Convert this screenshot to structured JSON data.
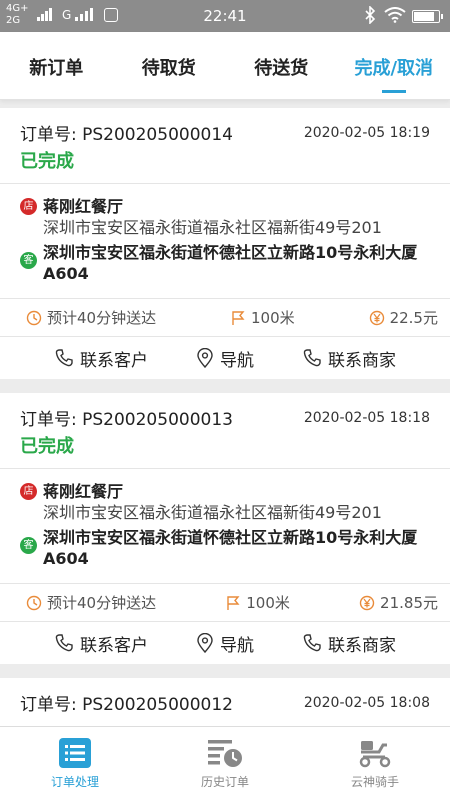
{
  "status_bar": {
    "net_top": "4G+",
    "net_bottom": "2G",
    "carrier2": "G",
    "time": "22:41"
  },
  "tabs": [
    {
      "label": "新订单"
    },
    {
      "label": "待取货"
    },
    {
      "label": "待送货"
    },
    {
      "label": "完成/取消"
    }
  ],
  "orders": [
    {
      "order_no": "订单号: PS200205000014",
      "time": "2020-02-05 18:19",
      "status": "已完成",
      "shop_icon": "店",
      "shop_name": "蒋刚红餐厅",
      "shop_address": "深圳市宝安区福永街道福永社区福新街49号201",
      "cust_icon": "客",
      "cust_address": "深圳市宝安区福永街道怀德社区立新路10号永利大厦A604",
      "eta": "预计40分钟送达",
      "distance": "100米",
      "fee": "22.5元",
      "btn_contact_customer": "联系客户",
      "btn_navigate": "导航",
      "btn_contact_merchant": "联系商家"
    },
    {
      "order_no": "订单号: PS200205000013",
      "time": "2020-02-05 18:18",
      "status": "已完成",
      "shop_icon": "店",
      "shop_name": "蒋刚红餐厅",
      "shop_address": "深圳市宝安区福永街道福永社区福新街49号201",
      "cust_icon": "客",
      "cust_address": "深圳市宝安区福永街道怀德社区立新路10号永利大厦A604",
      "eta": "预计40分钟送达",
      "distance": "100米",
      "fee": "21.85元",
      "btn_contact_customer": "联系客户",
      "btn_navigate": "导航",
      "btn_contact_merchant": "联系商家"
    },
    {
      "order_no": "订单号: PS200205000012",
      "time": "2020-02-05 18:08"
    }
  ],
  "bottom_nav": [
    {
      "label": "订单处理",
      "icon": "list-icon"
    },
    {
      "label": "历史订单",
      "icon": "history-icon"
    },
    {
      "label": "云神骑手",
      "icon": "scooter-icon"
    }
  ],
  "colors": {
    "accent": "#29a0d6",
    "status_done": "#2aa84a",
    "shop_badge": "#d42a2a",
    "cust_badge": "#2aa84a",
    "meta_icon": "#e98b3a"
  }
}
